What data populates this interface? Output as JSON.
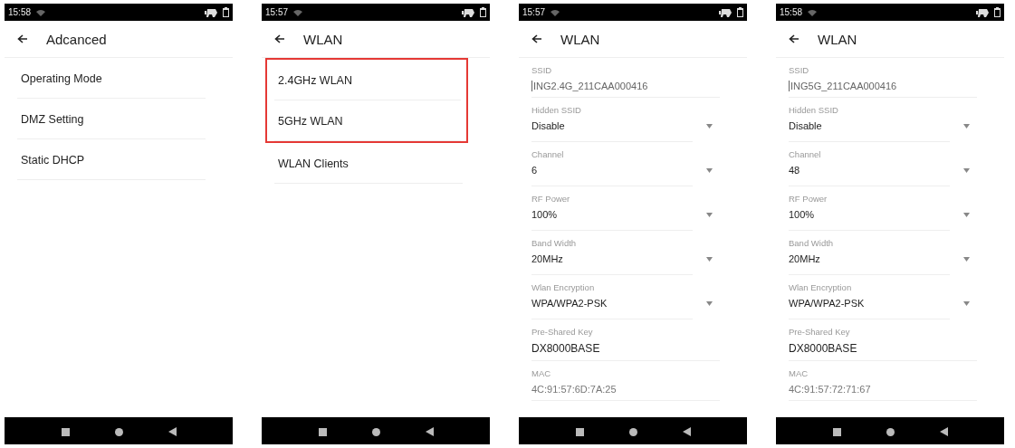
{
  "screens": [
    {
      "kind": "menu",
      "time": "15:58",
      "title": "Adcanced",
      "items": [
        {
          "label": "Operating Mode",
          "highlighted": false
        },
        {
          "label": "DMZ Setting",
          "highlighted": false
        },
        {
          "label": "Static DHCP",
          "highlighted": false
        }
      ]
    },
    {
      "kind": "menu",
      "time": "15:57",
      "title": "WLAN",
      "items": [
        {
          "label": "2.4GHz WLAN",
          "highlighted": true
        },
        {
          "label": "5GHz WLAN",
          "highlighted": true
        },
        {
          "label": "WLAN Clients",
          "highlighted": false
        }
      ]
    },
    {
      "kind": "form",
      "time": "15:57",
      "title": "WLAN",
      "fields": [
        {
          "kind": "input",
          "label": "SSID",
          "value": "ING2.4G_211CAA000416",
          "focused": true
        },
        {
          "kind": "dropdown",
          "label": "Hidden SSID",
          "value": "Disable"
        },
        {
          "kind": "dropdown",
          "label": "Channel",
          "value": "6"
        },
        {
          "kind": "dropdown",
          "label": "RF Power",
          "value": "100%"
        },
        {
          "kind": "dropdown",
          "label": "Band Width",
          "value": "20MHz"
        },
        {
          "kind": "dropdown",
          "label": "Wlan Encryption",
          "value": "WPA/WPA2-PSK"
        },
        {
          "kind": "input",
          "label": "Pre-Shared Key",
          "value": "DX8000BASE",
          "focused": false
        },
        {
          "kind": "readonly",
          "label": "MAC",
          "value": "4C:91:57:6D:7A:25"
        }
      ]
    },
    {
      "kind": "form",
      "time": "15:58",
      "title": "WLAN",
      "fields": [
        {
          "kind": "input",
          "label": "SSID",
          "value": "ING5G_211CAA000416",
          "focused": true
        },
        {
          "kind": "dropdown",
          "label": "Hidden SSID",
          "value": "Disable"
        },
        {
          "kind": "dropdown",
          "label": "Channel",
          "value": "48"
        },
        {
          "kind": "dropdown",
          "label": "RF Power",
          "value": "100%"
        },
        {
          "kind": "dropdown",
          "label": "Band Width",
          "value": "20MHz"
        },
        {
          "kind": "dropdown",
          "label": "Wlan Encryption",
          "value": "WPA/WPA2-PSK"
        },
        {
          "kind": "input",
          "label": "Pre-Shared Key",
          "value": "DX8000BASE",
          "focused": false
        },
        {
          "kind": "readonly",
          "label": "MAC",
          "value": "4C:91:57:72:71:67"
        }
      ]
    }
  ]
}
